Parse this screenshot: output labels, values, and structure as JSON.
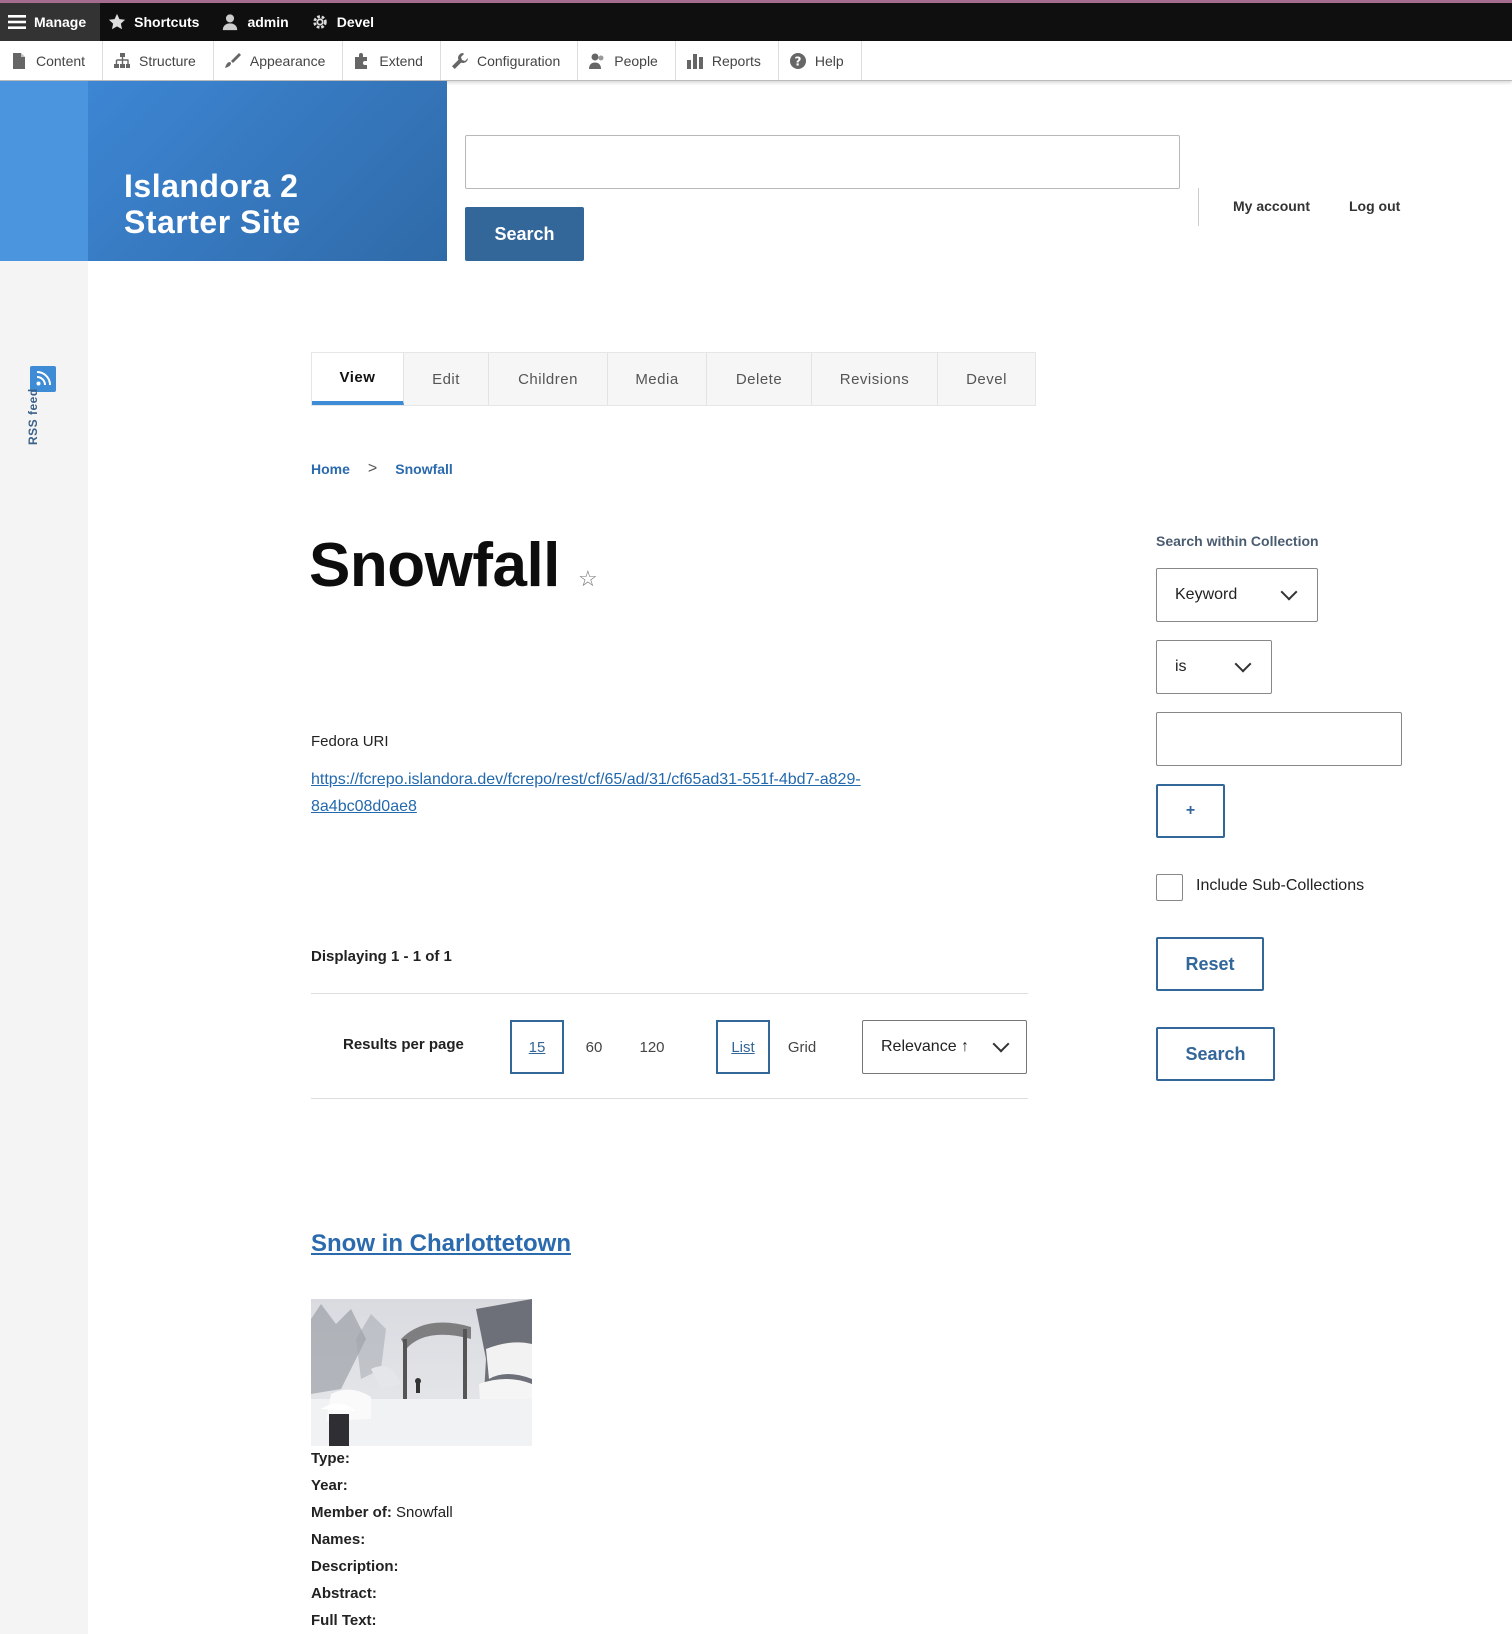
{
  "admin_toolbar": {
    "manage": "Manage",
    "shortcuts": "Shortcuts",
    "admin": "admin",
    "devel": "Devel"
  },
  "admin_tray": [
    {
      "label": "Content",
      "icon": "file-icon"
    },
    {
      "label": "Structure",
      "icon": "sitemap-icon"
    },
    {
      "label": "Appearance",
      "icon": "paintbrush-icon"
    },
    {
      "label": "Extend",
      "icon": "puzzle-icon"
    },
    {
      "label": "Configuration",
      "icon": "wrench-icon"
    },
    {
      "label": "People",
      "icon": "people-icon"
    },
    {
      "label": "Reports",
      "icon": "bar-chart-icon"
    },
    {
      "label": "Help",
      "icon": "question-icon"
    }
  ],
  "header": {
    "site_name_line1": "Islandora 2",
    "site_name_line2": "Starter Site",
    "search_value": "",
    "search_button": "Search",
    "my_account": "My account",
    "log_out": "Log out"
  },
  "sidebar": {
    "rss_label": "RSS feed"
  },
  "tabs": [
    "View",
    "Edit",
    "Children",
    "Media",
    "Delete",
    "Revisions",
    "Devel"
  ],
  "breadcrumb": {
    "home": "Home",
    "separator": ">",
    "current": "Snowfall"
  },
  "page": {
    "title": "Snowfall",
    "fedora_label": "Fedora URI",
    "fedora_uri": "https://fcrepo.islandora.dev/fcrepo/rest/cf/65/ad/31/cf65ad31-551f-4bd7-a829-8a4bc08d0ae8",
    "displaying": "Displaying 1 - 1 of 1"
  },
  "results_controls": {
    "results_per_page_label": "Results per page",
    "per_page_options": [
      "15",
      "60",
      "120"
    ],
    "per_page_selected": "15",
    "view_modes": [
      "List",
      "Grid"
    ],
    "view_selected": "List",
    "sort_selected": "Relevance ↑"
  },
  "result": {
    "title": "Snow in Charlottetown",
    "fields": [
      {
        "label": "Type:",
        "value": ""
      },
      {
        "label": "Year:",
        "value": ""
      },
      {
        "label": "Member of:",
        "value": " Snowfall"
      },
      {
        "label": "Names:",
        "value": ""
      },
      {
        "label": "Description:",
        "value": ""
      },
      {
        "label": "Abstract:",
        "value": ""
      },
      {
        "label": "Full Text:",
        "value": ""
      }
    ]
  },
  "collection_search": {
    "title": "Search within Collection",
    "field_select": "Keyword",
    "operator_select": "is",
    "value": "",
    "add_button": "+",
    "include_sub_label": "Include Sub-Collections",
    "include_sub_checked": false,
    "reset_button": "Reset",
    "search_button": "Search"
  },
  "colors": {
    "toolbar_bg": "#0f0f0f",
    "brand_blue": "#3c78b6",
    "accent_blue": "#3e8bd6",
    "link_blue": "#2a6aad",
    "button_blue": "#336699"
  }
}
